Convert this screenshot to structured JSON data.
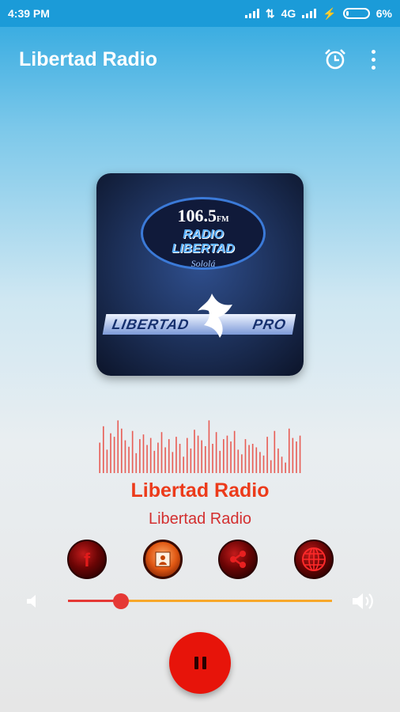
{
  "status_bar": {
    "time": "4:39 PM",
    "network": "4G",
    "battery": "6%"
  },
  "app_bar": {
    "title": "Libertad Radio",
    "alarm_icon": "alarm-clock-icon",
    "menu_icon": "more-vert-icon"
  },
  "station_logo": {
    "frequency": "106.5",
    "frequency_unit": "FM",
    "name_line1": "RADIO",
    "name_line2": "LIBERTAD",
    "city": "Sololá",
    "band_left": "LIBERTAD",
    "band_right": "PRO"
  },
  "now_playing": {
    "title": "Libertad Radio",
    "subtitle": "Libertad Radio"
  },
  "social": [
    {
      "icon": "facebook-icon"
    },
    {
      "icon": "web-b-icon"
    },
    {
      "icon": "share-icon"
    },
    {
      "icon": "globe-icon"
    }
  ],
  "volume": {
    "level": 0.2,
    "low_icon": "volume-low-icon",
    "high_icon": "volume-high-icon"
  },
  "player": {
    "state": "playing",
    "button_icon": "pause-icon"
  },
  "colors": {
    "status_bar": "#1b9bd8",
    "accent": "#e7140a",
    "title_red": "#ec3b1b",
    "slider_rest": "#f7a82a"
  },
  "visualizer_levels": [
    0.52,
    0.8,
    0.4,
    0.68,
    0.62,
    0.9,
    0.76,
    0.56,
    0.45,
    0.72,
    0.34,
    0.58,
    0.66,
    0.48,
    0.6,
    0.38,
    0.52,
    0.7,
    0.44,
    0.58,
    0.36,
    0.62,
    0.5,
    0.28,
    0.6,
    0.42,
    0.74,
    0.64,
    0.56,
    0.46,
    0.9,
    0.5,
    0.7,
    0.38,
    0.58,
    0.64,
    0.54,
    0.72,
    0.4,
    0.32,
    0.58,
    0.48,
    0.5,
    0.44,
    0.36,
    0.3,
    0.62,
    0.22,
    0.72,
    0.42,
    0.28,
    0.18,
    0.76,
    0.6,
    0.54,
    0.64
  ]
}
